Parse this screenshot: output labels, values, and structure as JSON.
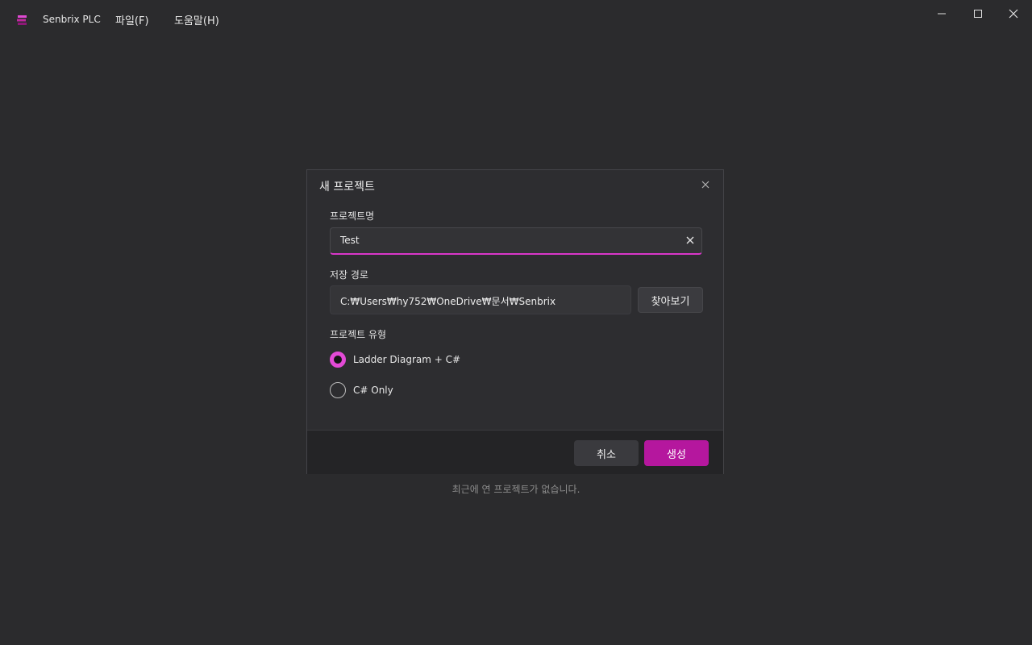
{
  "app": {
    "name": "Senbrix PLC",
    "logo_icon": "senbrix-logo-icon",
    "accent_color": "#d936c9"
  },
  "menu": {
    "file": "파일(F)",
    "help": "도움말(H)"
  },
  "window_controls": {
    "minimize_icon": "minimize-icon",
    "maximize_icon": "maximize-icon",
    "close_icon": "close-icon"
  },
  "dialog": {
    "title": "새 프로젝트",
    "close_icon": "close-icon",
    "project_name": {
      "label": "프로젝트명",
      "value": "Test",
      "clear_icon": "clear-icon"
    },
    "save_path": {
      "label": "저장 경로",
      "value": "C:₩Users₩hy752₩OneDrive₩문서₩Senbrix",
      "browse_label": "찾아보기"
    },
    "project_type": {
      "label": "프로젝트 유형",
      "options": [
        {
          "label": "Ladder Diagram + C#",
          "selected": true
        },
        {
          "label": "C# Only",
          "selected": false
        }
      ]
    },
    "buttons": {
      "cancel": "취소",
      "create": "생성"
    }
  },
  "recent": {
    "empty_text": "최근에 연 프로젝트가 없습니다."
  }
}
